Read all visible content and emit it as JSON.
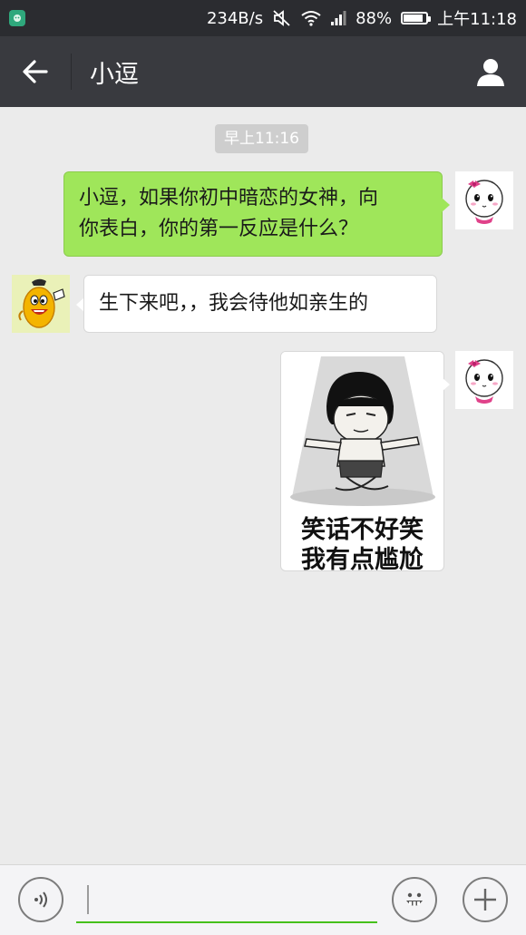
{
  "status_bar": {
    "network_speed": "234B/s",
    "battery_percent": "88%",
    "battery_level": 0.88,
    "time": "上午11:18",
    "icons": [
      "app-notification-icon",
      "mute-icon",
      "wifi-icon",
      "signal-icon",
      "battery-icon"
    ]
  },
  "header": {
    "title": "小逗",
    "back_icon": "arrow-left-icon",
    "profile_icon": "person-icon"
  },
  "chat": {
    "timestamp": "早上11:16",
    "messages": [
      {
        "sender": "me",
        "text_line1": "小逗，如果你初中暗恋的女神，向",
        "text_line2": "你表白，你的第一反应是什么？"
      },
      {
        "sender": "xiaodou",
        "text": "生下来吧，，我会待他如亲生的"
      },
      {
        "sender": "me",
        "type": "sticker",
        "caption_line1": "笑话不好笑",
        "caption_line2": "我有点尴尬"
      }
    ]
  },
  "input_bar": {
    "voice_icon": "voice-icon",
    "emoji_icon": "emoji-icon",
    "plus_icon": "plus-icon",
    "accent_color": "#46c01b"
  },
  "colors": {
    "status_bar": "#2b2c30",
    "title_bar": "#393a3f",
    "chat_background": "#ebebeb",
    "my_bubble": "#9fe65a",
    "their_bubble": "#ffffff"
  }
}
